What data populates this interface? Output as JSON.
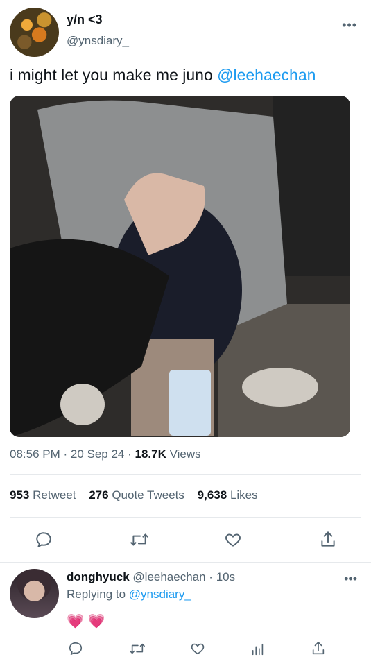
{
  "tweet": {
    "display_name": "y/n <3",
    "handle": "@ynsdiary_",
    "text_before": "i might let you make me juno ",
    "mention": "@leehaechan",
    "time": "08:56 PM",
    "date": "20 Sep 24",
    "views_count": "18.7K",
    "views_label": "Views",
    "retweets_count": "953",
    "retweets_label": "Retweet",
    "quotes_count": "276",
    "quotes_label": "Quote Tweets",
    "likes_count": "9,638",
    "likes_label": "Likes",
    "more_label": "•••"
  },
  "reply": {
    "display_name": "donghyuck",
    "handle": "@leehaechan",
    "age": "10s",
    "replying_prefix": "Replying to ",
    "replying_to": "@ynsdiary_",
    "hearts": "💗 💗",
    "more_label": "•••"
  },
  "colors": {
    "accent": "#1d9bf0",
    "muted": "#536471",
    "text": "#0f1419"
  },
  "icons": [
    "reply-icon",
    "retweet-icon",
    "like-icon",
    "share-icon",
    "analytics-icon"
  ]
}
